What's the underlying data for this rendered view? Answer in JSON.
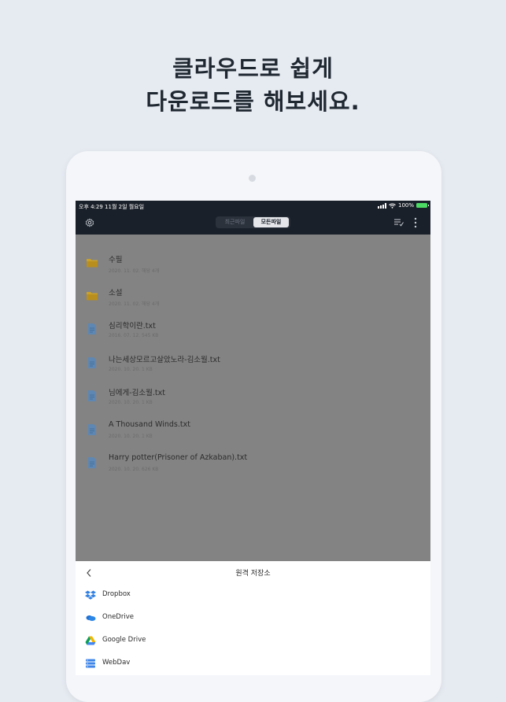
{
  "headline": {
    "line1": "클라우드로 쉽게",
    "line2": "다운로드를 해보세요."
  },
  "status_bar": {
    "time": "오후 4:29   11월 2일 월요일",
    "battery": "100%"
  },
  "toolbar": {
    "tabs": [
      {
        "label": "최근파일",
        "selected": false
      },
      {
        "label": "모든파일",
        "selected": true
      }
    ],
    "icons": [
      "gear-icon",
      "sort-icon",
      "more-vertical-icon"
    ]
  },
  "files": [
    {
      "type": "folder",
      "name": "수필",
      "meta": "2020. 11. 02. 해당 4개"
    },
    {
      "type": "folder",
      "name": "소설",
      "meta": "2020. 11. 02. 해당 4개"
    },
    {
      "type": "file",
      "name": "심리학이란.txt",
      "meta": "2016. 07. 12. 545 KB"
    },
    {
      "type": "file",
      "name": "나는세상모르고살았노라-김소월.txt",
      "meta": "2020. 10. 20. 1 KB"
    },
    {
      "type": "file",
      "name": "님에게-김소월.txt",
      "meta": "2020. 10. 20. 1 KB"
    },
    {
      "type": "file",
      "name": "A Thousand Winds.txt",
      "meta": "2020. 10. 20. 1 KB"
    },
    {
      "type": "file",
      "name": "Harry potter(Prisoner of Azkaban).txt",
      "meta": "2020. 10. 20. 626 KB"
    }
  ],
  "sheet": {
    "title": "원격 저장소",
    "services": [
      {
        "label": "Dropbox",
        "icon": "dropbox-icon"
      },
      {
        "label": "OneDrive",
        "icon": "onedrive-icon"
      },
      {
        "label": "Google Drive",
        "icon": "google-drive-icon"
      },
      {
        "label": "WebDav",
        "icon": "webdav-icon"
      }
    ]
  },
  "colors": {
    "background": "#e6eaf1",
    "topbar": "#1a2029",
    "overlay": "#838383",
    "folder": "#caa12a",
    "file": "#5e87b3"
  }
}
